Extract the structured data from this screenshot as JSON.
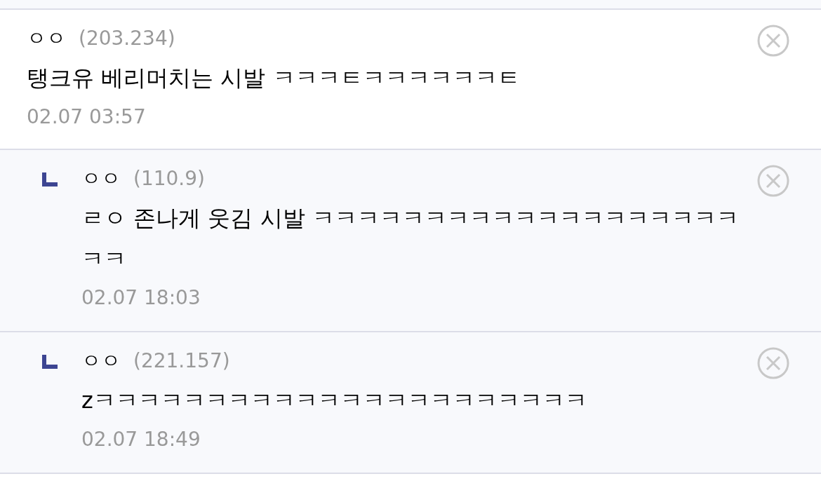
{
  "comments": [
    {
      "reply": false,
      "author": "ㅇㅇ",
      "ip": "(203.234)",
      "text": "탱크유 베리머치는 시발 ㅋㅋㅋㅌㅋㅋㅋㅋㅋㅋㅌ",
      "time": "02.07 03:57"
    },
    {
      "reply": true,
      "author": "ㅇㅇ",
      "ip": "(110.9)",
      "text": "ㄹㅇ 존나게 웃김 시발 ㅋㅋㅋㅋㅋㅋㅋㅋㅋㅋㅋㅋㅋㅋㅋㅋㅋㅋㅋㅋㅋ",
      "time": "02.07 18:03"
    },
    {
      "reply": true,
      "author": "ㅇㅇ",
      "ip": "(221.157)",
      "text": "zㅋㅋㅋㅋㅋㅋㅋㅋㅋㅋㅋㅋㅋㅋㅋㅋㅋㅋㅋㅋㅋㅋ",
      "time": "02.07 18:49"
    }
  ]
}
